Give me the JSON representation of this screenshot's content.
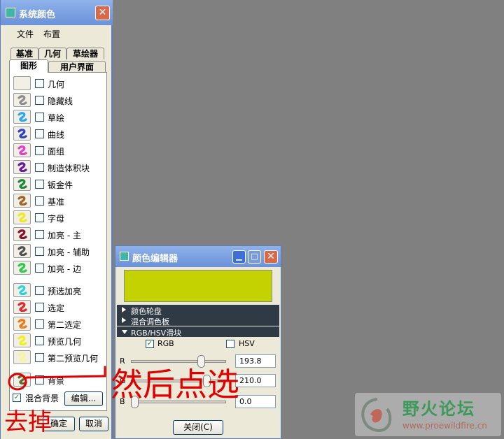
{
  "system_colors": {
    "title": "系统颜色",
    "menu": [
      "文件",
      "布置"
    ],
    "tabs_back": [
      "基准",
      "几何",
      "草绘器"
    ],
    "tabs_front": [
      "图形",
      "用户界面"
    ],
    "items": [
      {
        "label": "几何",
        "color": "#ffffff"
      },
      {
        "label": "隐藏线",
        "color": "#8c8c8c"
      },
      {
        "label": "草绘",
        "color": "#2aa6f0"
      },
      {
        "label": "曲线",
        "color": "#3040c8"
      },
      {
        "label": "面组",
        "color": "#e040c8"
      },
      {
        "label": "制造体积块",
        "color": "#6a1a9a"
      },
      {
        "label": "钣金件",
        "color": "#1a8a3a"
      },
      {
        "label": "基准",
        "color": "#a06428"
      },
      {
        "label": "字母",
        "color": "#f0e820"
      },
      {
        "label": "加亮 - 主",
        "color": "#8a1030"
      },
      {
        "label": "加亮 - 辅助",
        "color": "#505050"
      },
      {
        "label": "加亮 - 边",
        "color": "#30c850"
      },
      {
        "label": "预选加亮",
        "color": "#30d0e0"
      },
      {
        "label": "选定",
        "color": "#e02830"
      },
      {
        "label": "第二选定",
        "color": "#f07818"
      },
      {
        "label": "预览几何",
        "color": "#f0f020"
      },
      {
        "label": "第二预览几何",
        "color": "#f8f4a0"
      },
      {
        "label": "背景",
        "color": "#5a6a30"
      }
    ],
    "blend_bg_label": "混合背景",
    "edit_label": "编辑...",
    "ok_label": "确定",
    "cancel_label": "取消"
  },
  "color_editor": {
    "title": "颜色编辑器",
    "preview_color": "#c3d200",
    "sections": [
      "颜色轮盘",
      "混合调色板",
      "RGB/HSV滑块"
    ],
    "rgb_label": "RGB",
    "hsv_label": "HSV",
    "sliders": [
      {
        "label": "R",
        "value": "193.8",
        "fraction": 0.76
      },
      {
        "label": "G",
        "value": "210.0",
        "fraction": 0.82
      },
      {
        "label": "B",
        "value": "0.0",
        "fraction": 0.0
      }
    ],
    "close_label": "关闭(C)"
  },
  "annotation": {
    "text_right": "然后点选",
    "text_left": "去掉",
    "color": "#e00000"
  },
  "watermark": {
    "name": "野火论坛",
    "url": "www.proewildfire.cn"
  },
  "colors": {
    "desktop": "#808080",
    "titlebar": "#7aa0e0",
    "dialog_bg": "#ece9d8"
  }
}
